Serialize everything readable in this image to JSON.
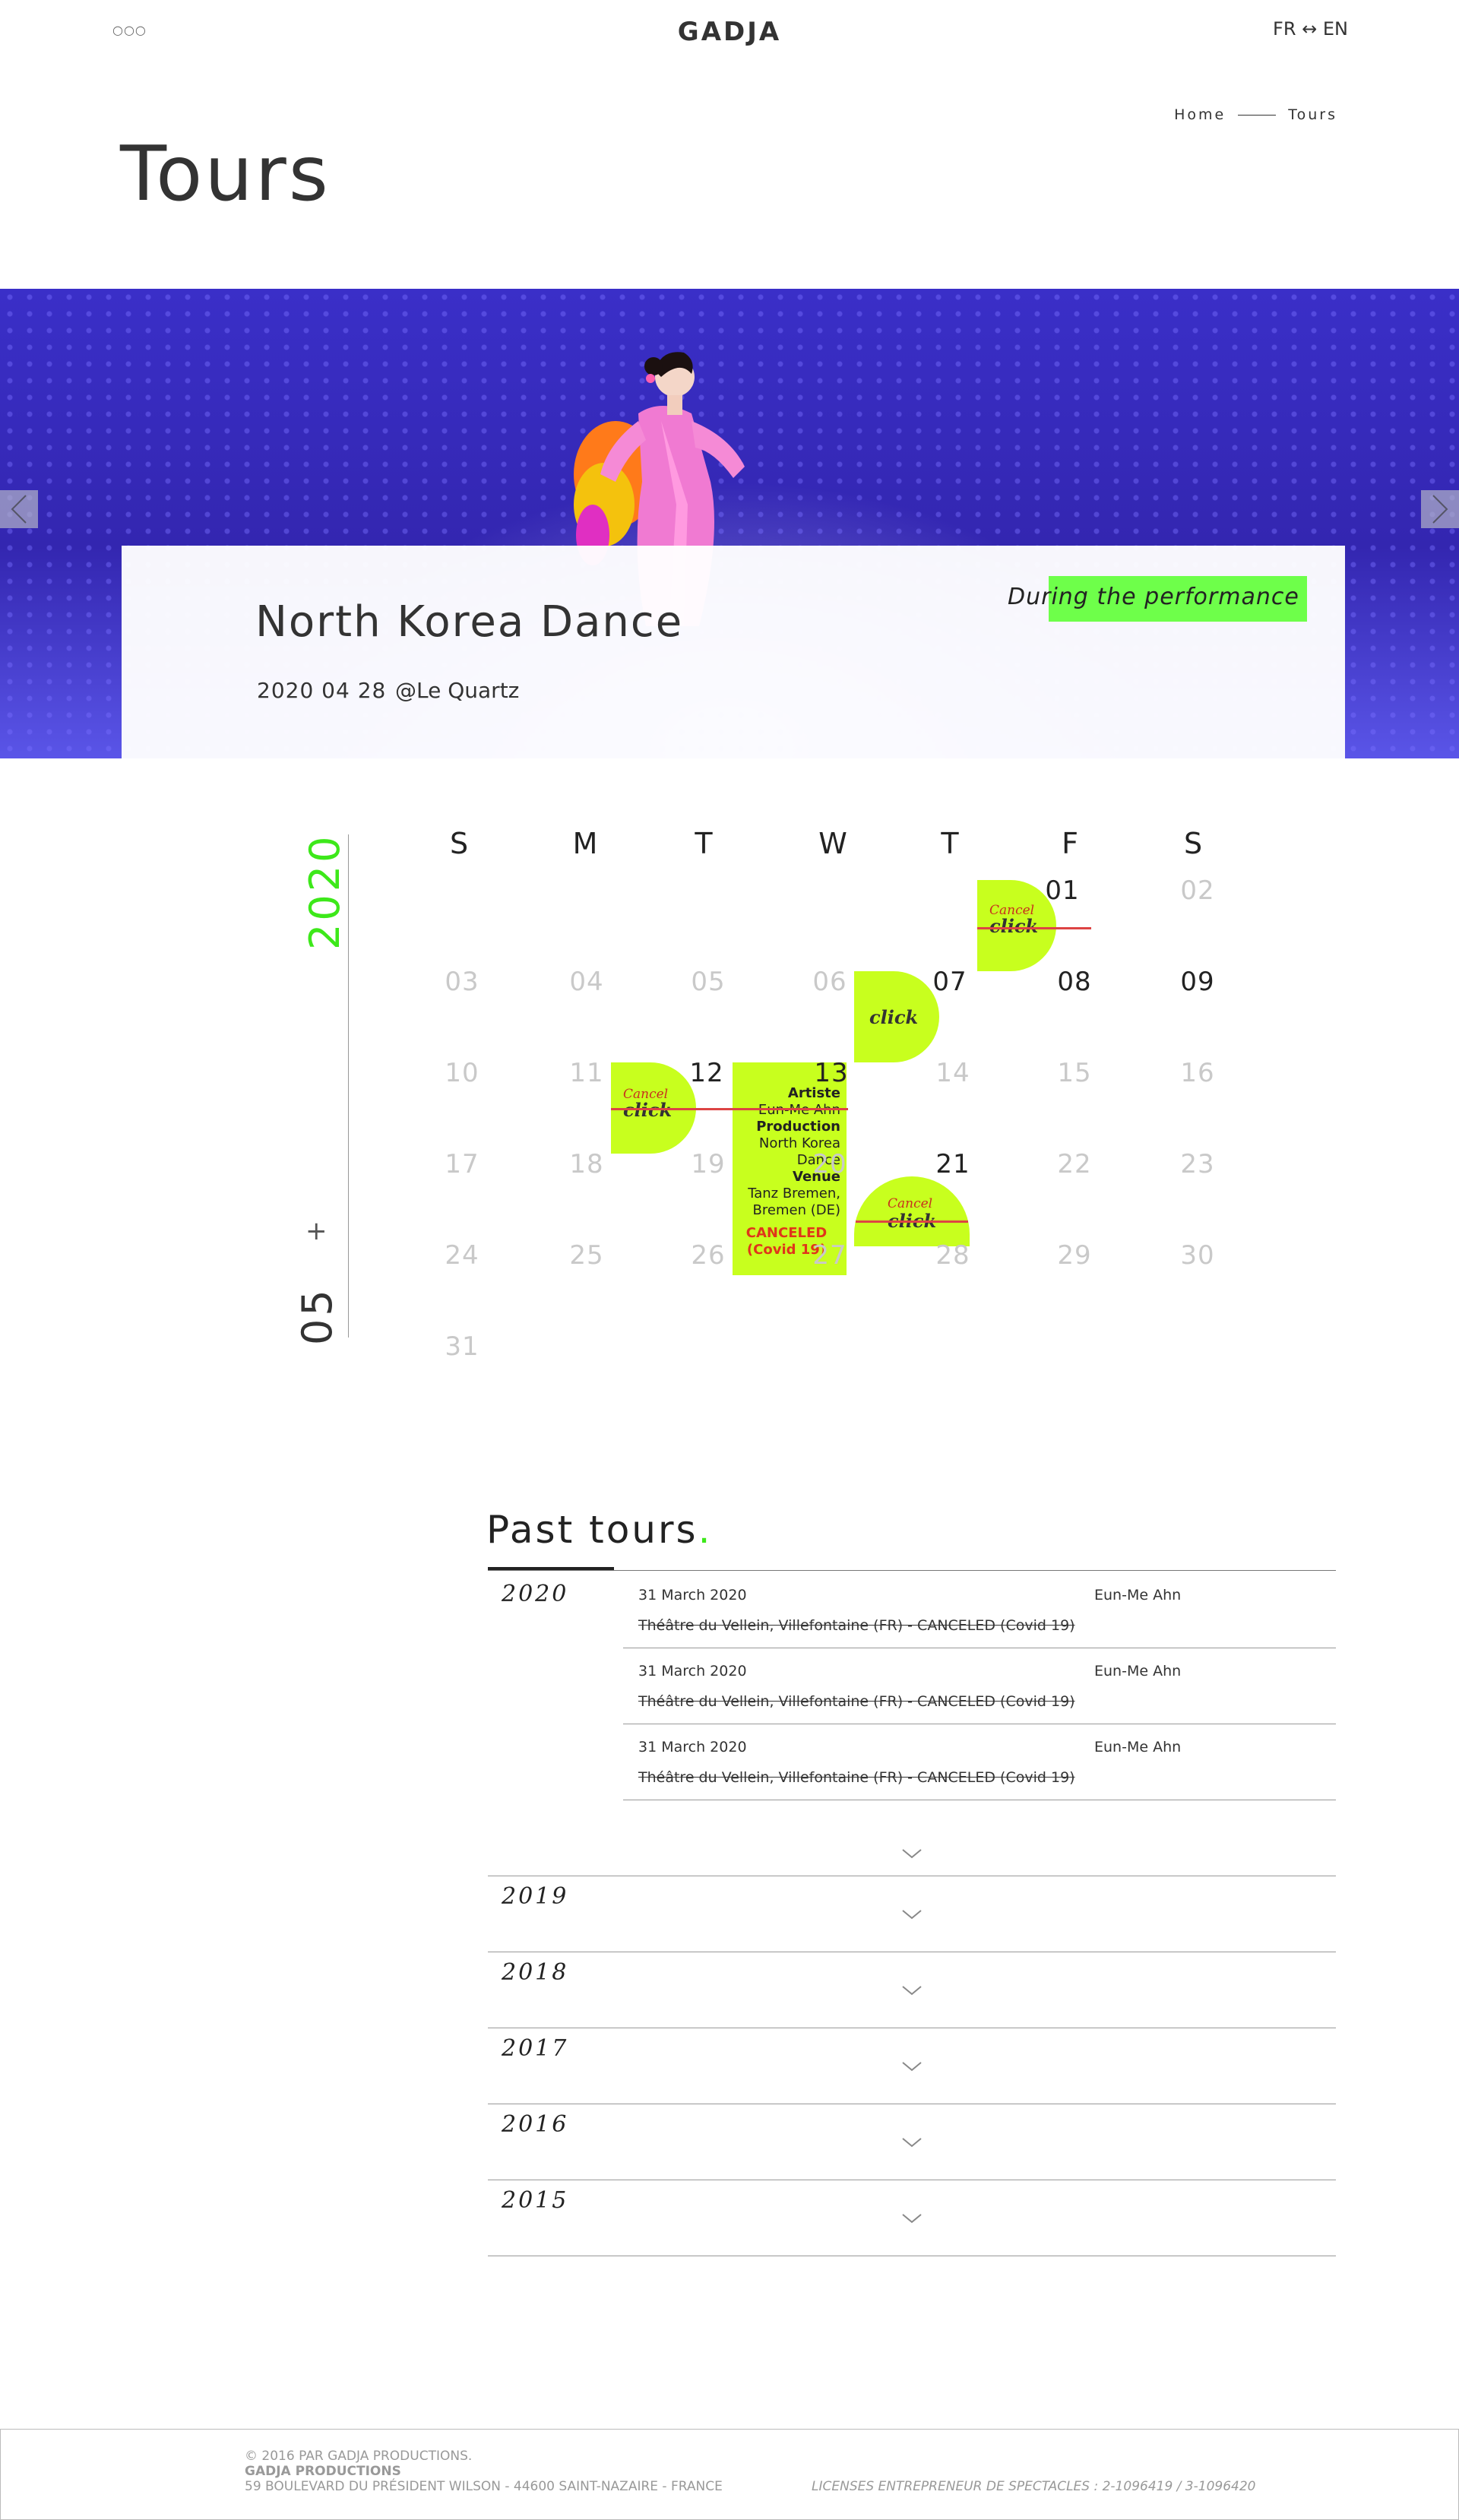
{
  "header": {
    "menu_dots": "○○○",
    "logo": "GADJA",
    "lang": "FR ↔ EN"
  },
  "breadcrumb": {
    "home": "Home",
    "current": "Tours"
  },
  "page_title": "Tours",
  "hero": {
    "event_title": "North Korea Dance",
    "event_date": "2020 04 28",
    "event_venue": "@Le Quartz",
    "during_label": "During the performance"
  },
  "calendar": {
    "year": "2020",
    "month": "05",
    "plus": "+",
    "weekdays": [
      "S",
      "M",
      "T",
      "W",
      "T",
      "F",
      "S"
    ],
    "cancel_label": "Cancel",
    "click_label": "click",
    "detail": {
      "day": "13",
      "artiste_label": "Artiste",
      "artiste": "Eun-Me Ahn",
      "production_label": "Production",
      "production": "North Korea Dance",
      "venue_label": "Venue",
      "venue": "Tanz Bremen, Bremen (DE)",
      "status": "CANCELED (Covid 19)"
    }
  },
  "past_tours": {
    "title": "Past tours",
    "title_dot": ".",
    "years": [
      "2020",
      "2019",
      "2018",
      "2017",
      "2016",
      "2015"
    ],
    "rows_2020": [
      {
        "date": "31 March 2020",
        "venue": "Théâtre du Vellein, Villefontaine (FR) - CANCELED (Covid 19)",
        "artist": "Eun-Me Ahn"
      },
      {
        "date": "31 March 2020",
        "venue": "Théâtre du Vellein, Villefontaine (FR) - CANCELED (Covid 19)",
        "artist": "Eun-Me Ahn"
      },
      {
        "date": "31 March 2020",
        "venue": "Théâtre du Vellein, Villefontaine (FR) - CANCELED (Covid 19)",
        "artist": "Eun-Me Ahn"
      }
    ]
  },
  "footer": {
    "copyright": "© 2016 PAR GADJA PRODUCTIONS.",
    "company": "GADJA PRODUCTIONS",
    "address": "59 BOULEVARD DU PRÉSIDENT WILSON - 44600 SAINT-NAZAIRE - FRANCE",
    "licenses": "LICENSES ENTREPRENEUR DE SPECTACLES : 2-1096419 / 3-1096420"
  },
  "colors": {
    "accent_green": "#3de81a",
    "highlight_lime": "#c8ff1e",
    "cancel_red": "#d44"
  }
}
